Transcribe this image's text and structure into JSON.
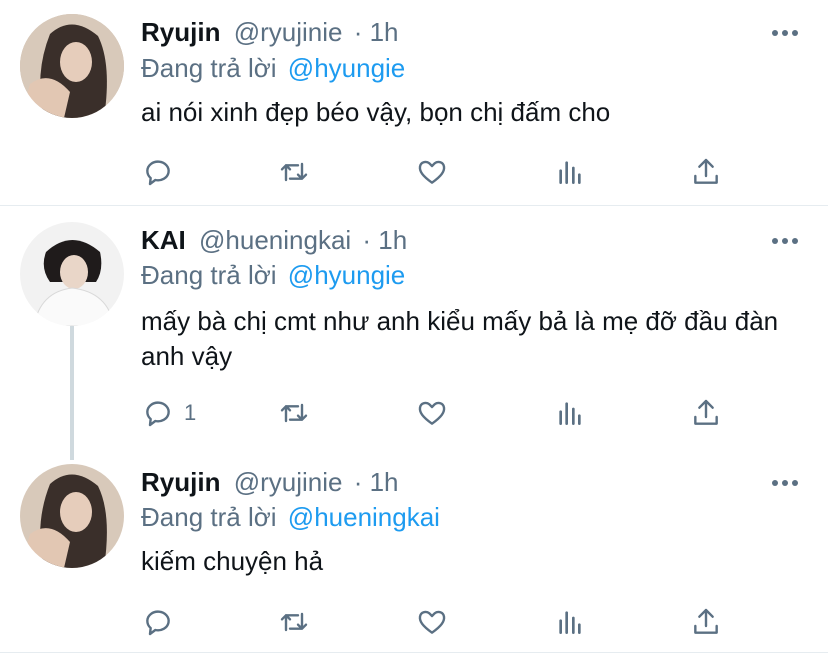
{
  "tweets": [
    {
      "name": "Ryujin",
      "handle": "@ryujinie",
      "time": "· 1h",
      "reply_prefix": "Đang trả lời",
      "reply_to": "@hyungie",
      "text": "ai nói xinh đẹp béo vậy, bọn chị đấm cho",
      "reply_count": ""
    },
    {
      "name": "KAI",
      "handle": "@hueningkai",
      "time": "· 1h",
      "reply_prefix": "Đang trả lời",
      "reply_to": "@hyungie",
      "text": "mấy bà chị cmt như anh kiểu mấy bả là mẹ đỡ đầu đàn anh vậy",
      "reply_count": "1"
    },
    {
      "name": "Ryujin",
      "handle": "@ryujinie",
      "time": "· 1h",
      "reply_prefix": "Đang trả lời",
      "reply_to": "@hueningkai",
      "text": "kiếm chuyện hả",
      "reply_count": ""
    }
  ],
  "colors": {
    "text": "#0f1419",
    "secondary": "#5b7083",
    "link": "#1d9bf0",
    "divider": "#e6ecf0"
  },
  "icons": [
    "reply-icon",
    "retweet-icon",
    "like-icon",
    "analytics-icon",
    "share-icon",
    "more-icon"
  ]
}
